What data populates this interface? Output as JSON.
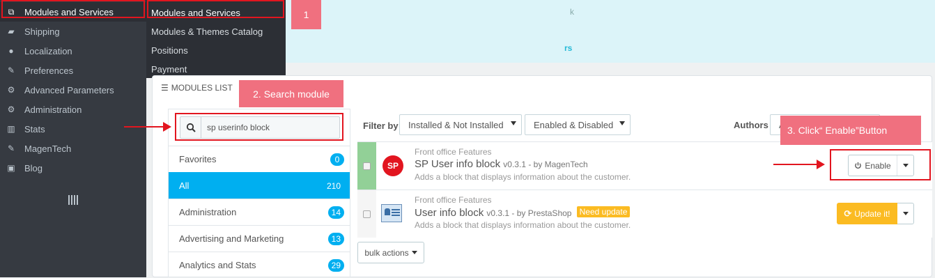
{
  "sidebar": {
    "items": [
      {
        "label": "Modules and Services",
        "icon": "puzzle-icon",
        "glyph": "⧉"
      },
      {
        "label": "Shipping",
        "icon": "truck-icon",
        "glyph": "▰"
      },
      {
        "label": "Localization",
        "icon": "globe-icon",
        "glyph": "●"
      },
      {
        "label": "Preferences",
        "icon": "wrench-icon",
        "glyph": "✎"
      },
      {
        "label": "Advanced Parameters",
        "icon": "cogs-icon",
        "glyph": "⚙"
      },
      {
        "label": "Administration",
        "icon": "gear-icon",
        "glyph": "⚙"
      },
      {
        "label": "Stats",
        "icon": "bar-chart-icon",
        "glyph": "▥"
      },
      {
        "label": "MagenTech",
        "icon": "wrench-icon",
        "glyph": "✎"
      },
      {
        "label": "Blog",
        "icon": "edit-icon",
        "glyph": "▣"
      }
    ]
  },
  "submenu": {
    "items": [
      "Modules and Services",
      "Modules & Themes Catalog",
      "Positions",
      "Payment"
    ]
  },
  "banner": {
    "k_text": "k",
    "link_text": "rs"
  },
  "annotations": {
    "step1": "1",
    "step2": "2. Search module",
    "step3": "3. Click“ Enable”Button"
  },
  "panel": {
    "heading": "MODULES LIST"
  },
  "search": {
    "value": "sp userinfo block"
  },
  "categories": [
    {
      "label": "Favorites",
      "count": "0"
    },
    {
      "label": "All",
      "count": "210"
    },
    {
      "label": "Administration",
      "count": "14"
    },
    {
      "label": "Advertising and Marketing",
      "count": "13"
    },
    {
      "label": "Analytics and Stats",
      "count": "29"
    }
  ],
  "filters": {
    "label": "Filter by",
    "install_select": "Installed & Not Installed",
    "enable_select": "Enabled & Disabled",
    "authors_label": "Authors",
    "authors_select": "A"
  },
  "modules": [
    {
      "category": "Front office Features",
      "name": "SP User info block",
      "version": "v0.3.1 - by MagenTech",
      "description": "Adds a block that displays information about the customer.",
      "logo_text": "SP",
      "action": "Enable"
    },
    {
      "category": "Front office Features",
      "name": "User info block",
      "version": "v0.3.1 - by PrestaShop",
      "badge": "Need update",
      "description": "Adds a block that displays information about the customer.",
      "action": "Update it!"
    }
  ],
  "bulk_actions": "bulk actions",
  "colors": {
    "sidebar": "#363a41",
    "accent": "#00aff0",
    "annotation_red": "#e2151f",
    "annotation_tag": "#f0707f",
    "warning": "#fbbb22",
    "enabled_strip": "#92d097"
  }
}
